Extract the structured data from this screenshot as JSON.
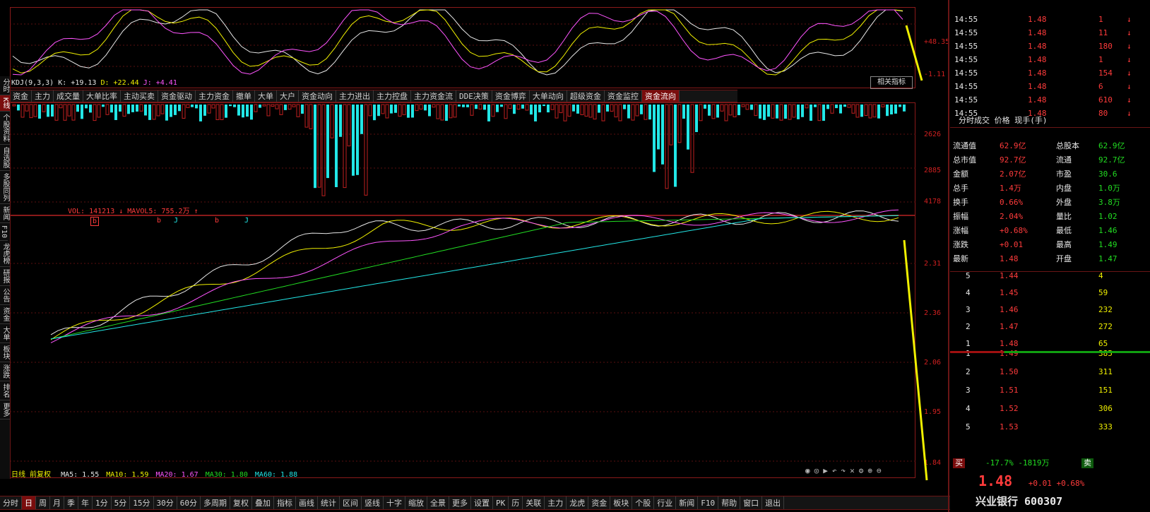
{
  "kdj": {
    "params": "KDJ(9,3,3)",
    "k": "K: +19.13",
    "d": "D: +22.44",
    "j": "J: +4.41",
    "ylabels": [
      "+48.35",
      "-1.11"
    ],
    "right_button": "相关指标"
  },
  "indicator_tabs": [
    "资金",
    "主力",
    "成交量",
    "大单比率",
    "主动买卖",
    "资金驱动",
    "主力资金",
    "撤单",
    "大单",
    "大户",
    "资金动向",
    "主力进出",
    "主力控盘",
    "主力资金流",
    "DDE决策",
    "资金博弈",
    "大单动向",
    "超级资金",
    "资金监控",
    "资金流向"
  ],
  "volume": {
    "legend": "VOL: 141213 ↓ MAVOL5: 755.2万 ↑",
    "ylabels": [
      "2626",
      "2885",
      "4178"
    ]
  },
  "main": {
    "ylabels": [
      "2.31",
      "2.36",
      "2.06",
      "1.95",
      "1.84"
    ],
    "ma_legend": [
      {
        "label": "MA5: 1.55",
        "color": "#e8e8e8"
      },
      {
        "label": "MA10: 1.59",
        "color": "#f0f000"
      },
      {
        "label": "MA20: 1.67",
        "color": "#ff55ff"
      },
      {
        "label": "MA30: 1.80",
        "color": "#22dd22"
      },
      {
        "label": "MA60: 1.88",
        "color": "#22e6e6"
      }
    ],
    "markers": [
      "b",
      "b",
      "J",
      "b",
      "J"
    ],
    "period_label": "日线 前复权"
  },
  "left_tabs": [
    "分时",
    "K线",
    "个股资料",
    "自选股",
    "多股同列",
    "新闻",
    "F10",
    "龙虎榜",
    "研报",
    "公告",
    "资金",
    "大单",
    "板块",
    "涨跌",
    "排名",
    "更多"
  ],
  "bottom_tabs": [
    "分时",
    "日",
    "周",
    "月",
    "季",
    "年",
    "1分",
    "5分",
    "15分",
    "30分",
    "60分",
    "多周期",
    "复权",
    "叠加",
    "指标",
    "画线",
    "统计",
    "区间",
    "竖线",
    "十字",
    "缩放",
    "全景",
    "更多",
    "设置",
    "PK",
    "历",
    "关联",
    "主力",
    "龙虎",
    "资金",
    "板块",
    "个股",
    "行业",
    "新闻",
    "F10",
    "帮助",
    "窗口",
    "退出"
  ],
  "side_quote": {
    "title": "兴业银行 600307",
    "price": "1.48",
    "change": "+0.01 +0.68%",
    "badges": [
      "买",
      "卖"
    ],
    "stats": "-17.7% -1819万",
    "asks": [
      {
        "level": "5",
        "price": "1.53",
        "vol": "333"
      },
      {
        "level": "4",
        "price": "1.52",
        "vol": "306"
      },
      {
        "level": "3",
        "price": "1.51",
        "vol": "151"
      },
      {
        "level": "2",
        "price": "1.50",
        "vol": "311"
      },
      {
        "level": "1",
        "price": "1.49",
        "vol": "385"
      }
    ],
    "bids": [
      {
        "level": "1",
        "price": "1.48",
        "vol": "65"
      },
      {
        "level": "2",
        "price": "1.47",
        "vol": "272"
      },
      {
        "level": "3",
        "price": "1.46",
        "vol": "232"
      },
      {
        "level": "4",
        "price": "1.45",
        "vol": "59"
      },
      {
        "level": "5",
        "price": "1.44",
        "vol": "4"
      }
    ],
    "info": [
      {
        "k": "最新",
        "v": "1.48",
        "k2": "开盘",
        "v2": "1.47"
      },
      {
        "k": "涨跌",
        "v": "+0.01",
        "k2": "最高",
        "v2": "1.49"
      },
      {
        "k": "涨幅",
        "v": "+0.68%",
        "k2": "最低",
        "v2": "1.46"
      },
      {
        "k": "振幅",
        "v": "2.04%",
        "k2": "量比",
        "v2": "1.02"
      },
      {
        "k": "换手",
        "v": "0.66%",
        "k2": "外盘",
        "v2": "3.8万"
      },
      {
        "k": "总手",
        "v": "1.4万",
        "k2": "内盘",
        "v2": "1.0万"
      },
      {
        "k": "金额",
        "v": "2.07亿",
        "k2": "市盈",
        "v2": "30.6"
      },
      {
        "k": "总市值",
        "v": "92.7亿",
        "k2": "流通",
        "v2": "92.7亿"
      },
      {
        "k": "流通值",
        "v": "62.9亿",
        "k2": "总股本",
        "v2": "62.9亿"
      }
    ],
    "header_row": "分时成交 价格 现手(手)",
    "ticks": [
      {
        "t": "14:55",
        "p": "1.48",
        "v": "80",
        "dir": "↓"
      },
      {
        "t": "14:55",
        "p": "1.48",
        "v": "610",
        "dir": "↓"
      },
      {
        "t": "14:55",
        "p": "1.48",
        "v": "6",
        "dir": "↓"
      },
      {
        "t": "14:55",
        "p": "1.48",
        "v": "154",
        "dir": "↓"
      },
      {
        "t": "14:55",
        "p": "1.48",
        "v": "1",
        "dir": "↓"
      },
      {
        "t": "14:55",
        "p": "1.48",
        "v": "180",
        "dir": "↓"
      },
      {
        "t": "14:55",
        "p": "1.48",
        "v": "11",
        "dir": "↓"
      },
      {
        "t": "14:55",
        "p": "1.48",
        "v": "1",
        "dir": "↓"
      }
    ]
  },
  "colors": {
    "up": "#ff3b3b",
    "down": "#22e6e6",
    "frame": "#8a1a1a",
    "accent": "#f0f000"
  }
}
